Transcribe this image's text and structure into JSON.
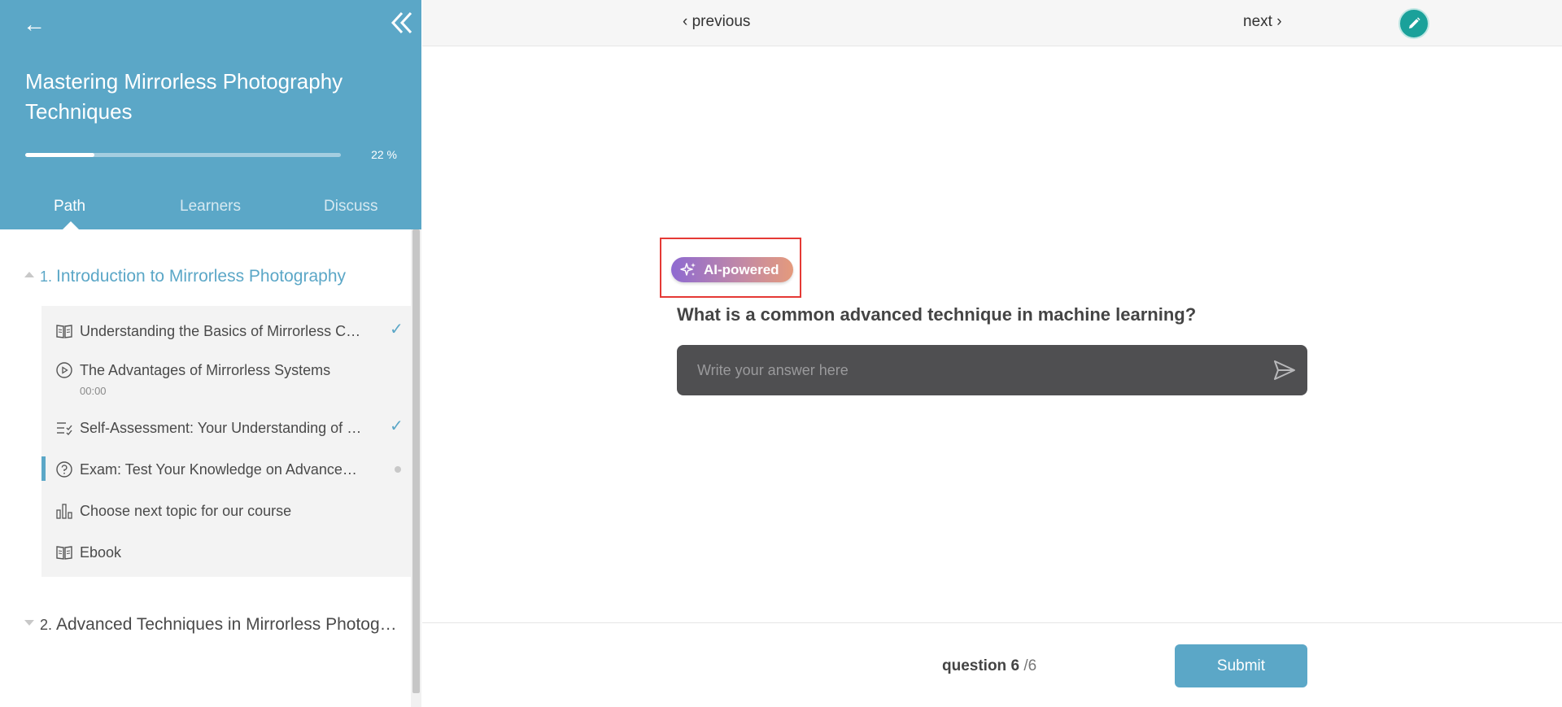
{
  "sidebar": {
    "back_icon": "left-arrow-icon",
    "collapse_icon": "double-chevron-left-icon",
    "course_title": "Mastering Mirrorless Photography Techniques",
    "progress_percent": 22,
    "progress_label": "22 %",
    "tabs": [
      {
        "label": "Path",
        "active": true
      },
      {
        "label": "Learners",
        "active": false
      },
      {
        "label": "Discuss",
        "active": false
      }
    ],
    "sections": [
      {
        "number": "1.",
        "title": "Introduction to Mirrorless Photography",
        "expanded": true,
        "lessons": [
          {
            "icon": "book-icon",
            "title": "Understanding the Basics of Mirrorless Cameras",
            "status": "completed",
            "check": "✓"
          },
          {
            "icon": "play-circle-icon",
            "title": "The Advantages of Mirrorless Systems",
            "duration": "00:00",
            "status": "none"
          },
          {
            "icon": "checklist-icon",
            "title": "Self-Assessment: Your Understanding of Mirrorless",
            "status": "completed",
            "check": "✓"
          },
          {
            "icon": "question-circle-icon",
            "title": "Exam: Test Your Knowledge on Advanced Techniques",
            "status": "current"
          },
          {
            "icon": "bar-chart-icon",
            "title": "Choose next topic for our course",
            "status": "none"
          },
          {
            "icon": "book-icon",
            "title": "Ebook",
            "status": "none"
          }
        ]
      },
      {
        "number": "2.",
        "title": "Advanced Techniques in Mirrorless Photography",
        "expanded": false
      }
    ]
  },
  "topbar": {
    "previous_label": "‹ previous",
    "next_label": "next ›",
    "edit_icon": "pencil-icon"
  },
  "main": {
    "badge_label": "AI-powered",
    "badge_icon": "sparkles-icon",
    "question": "What is a common advanced technique in machine learning?",
    "answer_placeholder": "Write your answer here",
    "answer_value": "",
    "send_icon": "send-icon"
  },
  "footer": {
    "question_word": "question",
    "current": "6",
    "total": "/6",
    "submit_label": "Submit"
  },
  "colors": {
    "primary": "#5ba7c7",
    "edit_button": "#1aa19a",
    "answer_bg": "#4f4f51",
    "highlight": "#e53935"
  }
}
